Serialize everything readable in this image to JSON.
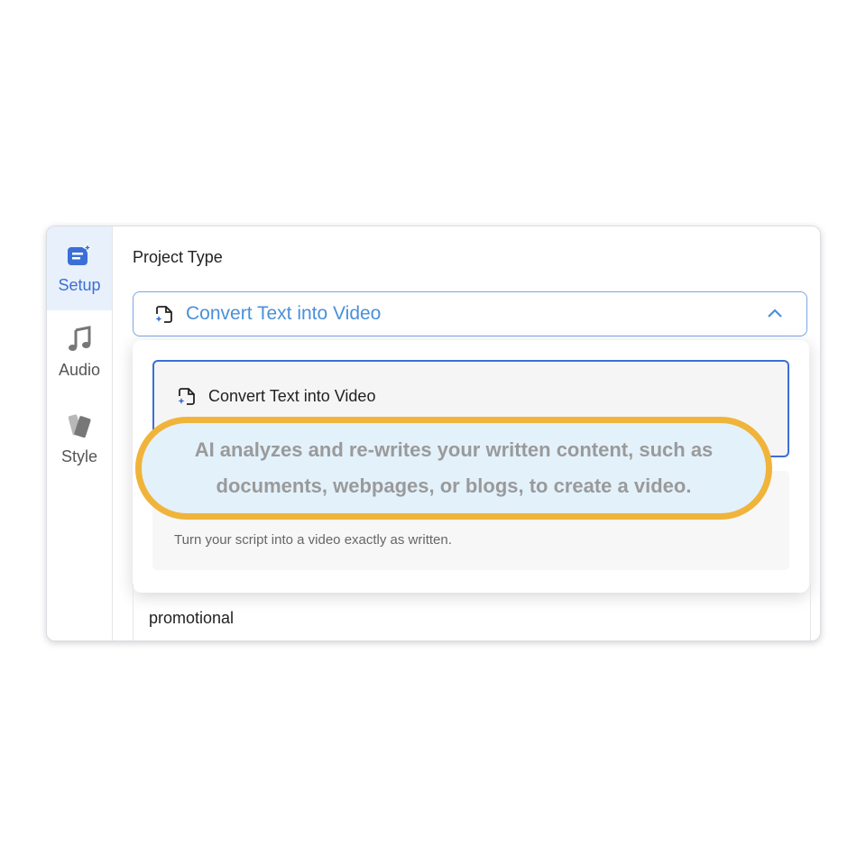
{
  "sidebar": {
    "items": [
      {
        "label": "Setup",
        "icon": "setup-icon",
        "active": true
      },
      {
        "label": "Audio",
        "icon": "music-note-icon",
        "active": false
      },
      {
        "label": "Style",
        "icon": "style-swatch-icon",
        "active": false
      }
    ]
  },
  "main": {
    "section_title": "Project Type",
    "select": {
      "value": "Convert Text into Video"
    },
    "dropdown": {
      "options": [
        {
          "title": "Convert Text into Video"
        },
        {
          "description": "Turn your script into a video exactly as written."
        }
      ]
    },
    "below_text": "promotional"
  },
  "highlight": {
    "text": "AI analyzes and re-writes your written content, such as documents, webpages, or blogs, to create a video."
  },
  "colors": {
    "accent": "#3b6fd6",
    "select_text": "#4a90d9",
    "highlight_border": "#f0b43a",
    "highlight_fill": "#e3f1fb"
  }
}
